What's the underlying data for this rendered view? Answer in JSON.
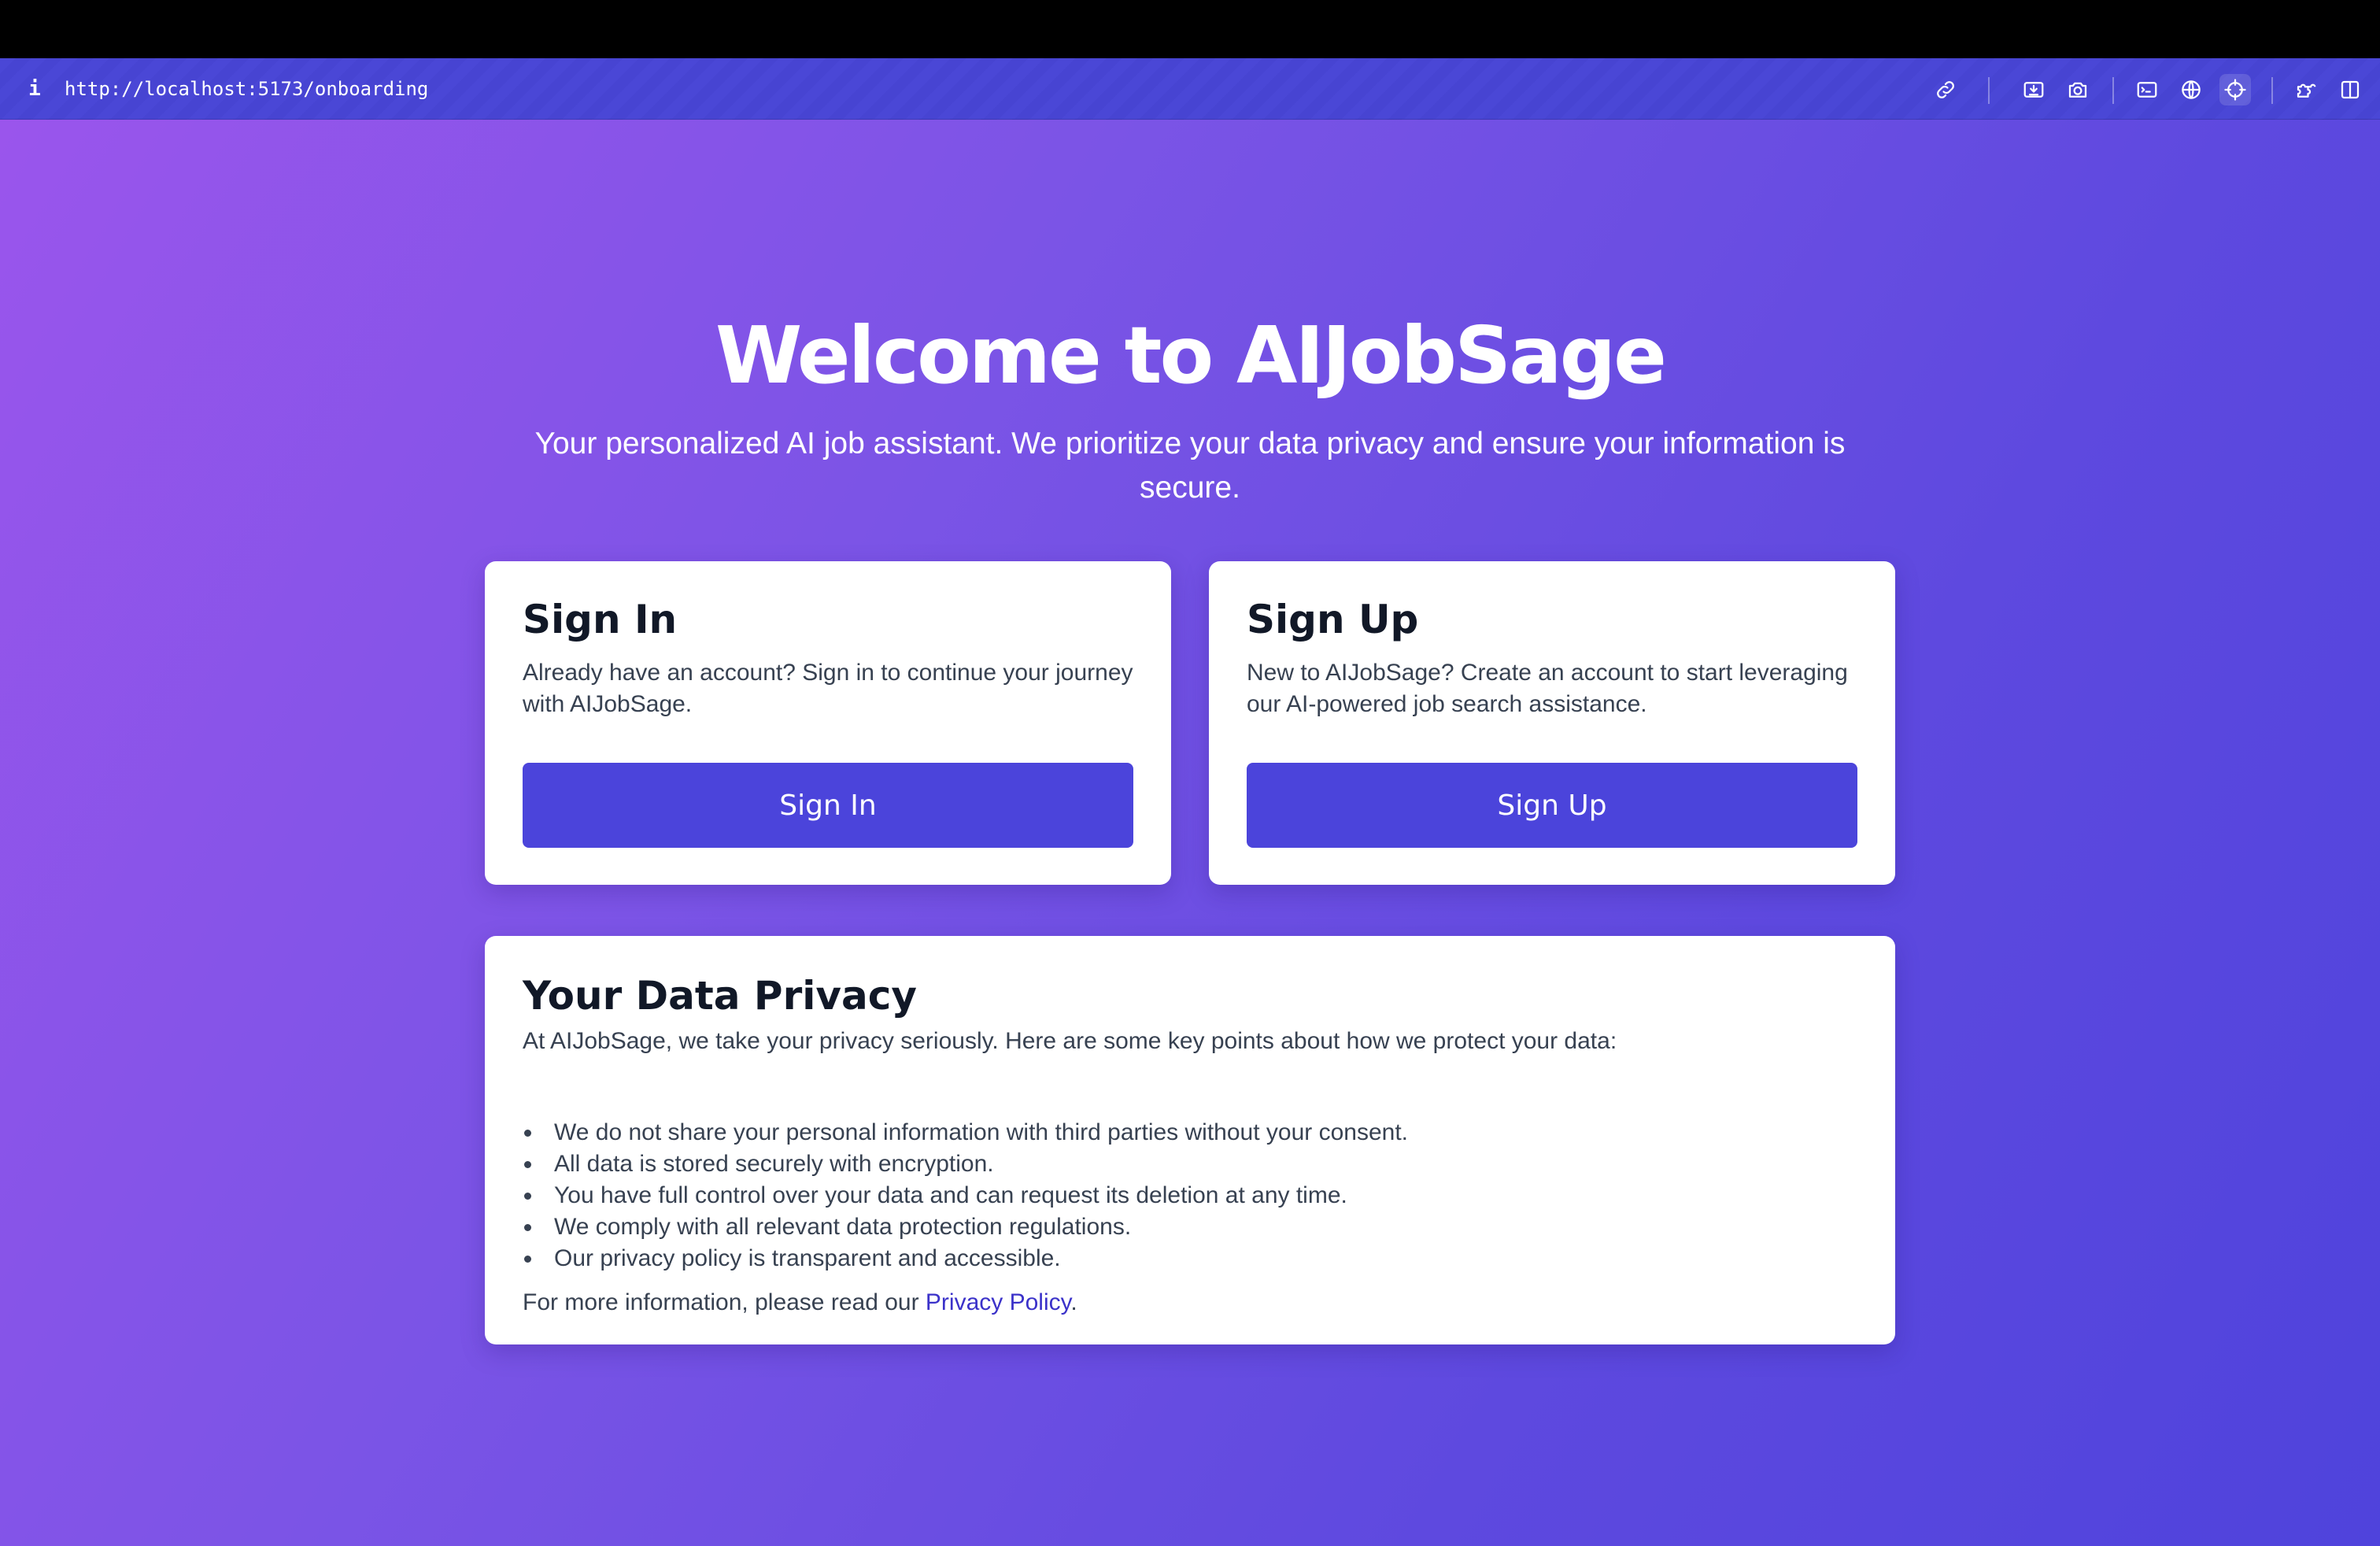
{
  "browser": {
    "info_glyph": "i",
    "url": "http://localhost:5173/onboarding",
    "toolbar_icons": [
      "link-icon",
      "download-icon",
      "camera-icon",
      "terminal-icon",
      "globe-icon",
      "crosshair-icon",
      "extensions-icon",
      "split-view-icon"
    ]
  },
  "hero": {
    "title": "Welcome to AIJobSage",
    "subtitle": "Your personalized AI job assistant. We prioritize your data privacy and ensure your information is secure."
  },
  "sign_in": {
    "title": "Sign In",
    "description": "Already have an account? Sign in to continue your journey with AIJobSage.",
    "button_label": "Sign In"
  },
  "sign_up": {
    "title": "Sign Up",
    "description": "New to AIJobSage? Create an account to start leveraging our AI-powered job search assistance.",
    "button_label": "Sign Up"
  },
  "privacy": {
    "title": "Your Data Privacy",
    "intro": "At AIJobSage, we take your privacy seriously. Here are some key points about how we protect your data:",
    "points": [
      "We do not share your personal information with third parties without your consent.",
      "All data is stored securely with encryption.",
      "You have full control over your data and can request its deletion at any time.",
      "We comply with all relevant data protection regulations.",
      "Our privacy policy is transparent and accessible."
    ],
    "more_info_prefix": "For more information, please read our ",
    "policy_link_label": "Privacy Policy",
    "more_info_suffix": "."
  },
  "colors": {
    "gradient_start": "#9a55ec",
    "gradient_end": "#4f43dc",
    "button": "#4b44db",
    "link": "#3b32c9",
    "url_bar": "#4a47d6"
  }
}
